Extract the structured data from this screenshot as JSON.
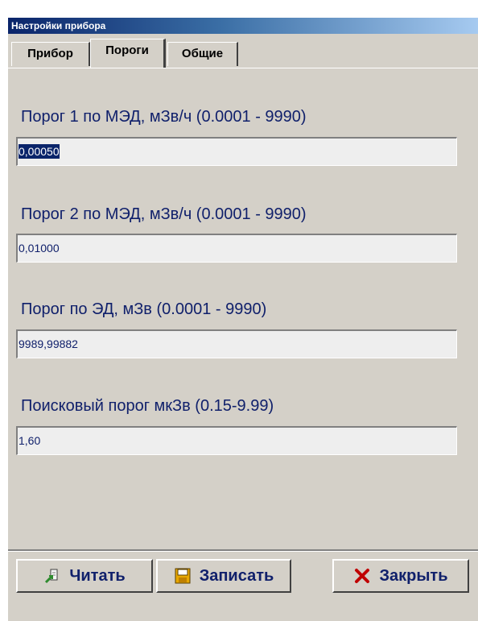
{
  "window": {
    "title": "Настройки прибора"
  },
  "tabs": [
    {
      "label": "Прибор",
      "active": false
    },
    {
      "label": "Пороги",
      "active": true
    },
    {
      "label": "Общие",
      "active": false
    }
  ],
  "fields": [
    {
      "label": "Порог 1 по МЭД, мЗв/ч (0.0001 - 9990)",
      "value": "0,00050",
      "selected": true
    },
    {
      "label": "Порог 2 по МЭД, мЗв/ч (0.0001 - 9990)",
      "value": "0,01000"
    },
    {
      "label": "Порог по ЭД, мЗв (0.0001 - 9990)",
      "value": "9989,99882"
    },
    {
      "label": "Поисковый порог мкЗв (0.15-9.99)",
      "value": "1,60"
    }
  ],
  "buttons": {
    "read": {
      "label": "Читать",
      "icon": "read-icon"
    },
    "write": {
      "label": "Записать",
      "icon": "save-icon"
    },
    "close": {
      "label": "Закрыть",
      "icon": "close-icon"
    }
  },
  "colors": {
    "title_bar": "#0a246a",
    "text": "#10206b",
    "face": "#d4d0c8",
    "input_bg": "#eeeeee",
    "close_x": "#c00000"
  }
}
